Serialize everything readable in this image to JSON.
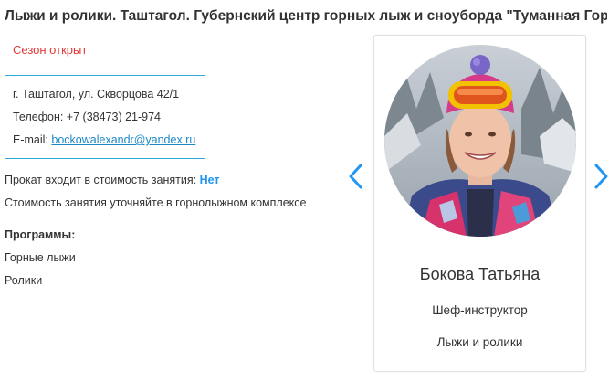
{
  "page": {
    "title": "Лыжи и ролики. Таштагол. Губернский центр горных лыж и сноуборда \"Туманная Гора\"",
    "season_status": "Сезон открыт"
  },
  "contacts": {
    "address": "г. Таштагол, ул. Скворцова 42/1",
    "phone": "Телефон: +7 (38473) 21-974",
    "email_label": "E-mail: ",
    "email": "bockowalexandr@yandex.ru"
  },
  "info": {
    "rental_label": "Прокат входит в стоимость занятия: ",
    "rental_value": "Нет",
    "price_note": "Стоимость занятия уточняйте в горнолыжном комплексе"
  },
  "programs": {
    "title": "Программы:",
    "items": [
      "Горные лыжи",
      "Ролики"
    ]
  },
  "instructor": {
    "name": "Бокова Татьяна",
    "role": "Шеф-инструктор",
    "sport": "Лыжи и ролики"
  },
  "icons": {
    "prev": "chevron-left-icon",
    "next": "chevron-right-icon"
  },
  "colors": {
    "accent": "#2196f3",
    "season": "#e53935",
    "box_border": "#2ca8d2",
    "link": "#1e88c7"
  }
}
